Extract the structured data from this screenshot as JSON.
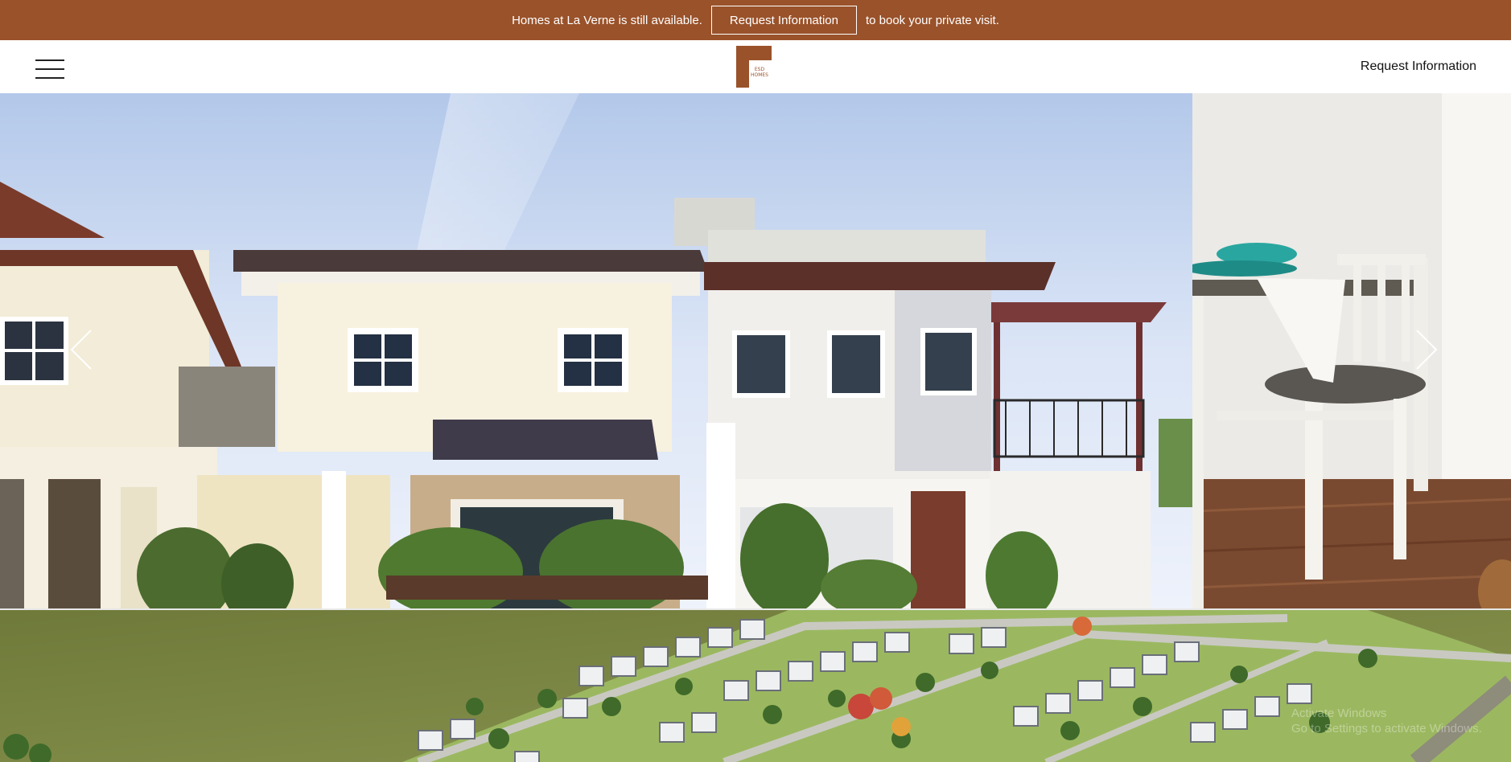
{
  "announcement": {
    "text_before": "Homes at La Verne is still available.",
    "button_label": "Request Information",
    "text_after": "to book your private visit.",
    "background_color": "#9a522a"
  },
  "header": {
    "menu_icon": "hamburger-menu-icon",
    "logo_text_line1": "ESD",
    "logo_text_line2": "HOMES",
    "logo_color": "#9a522a",
    "request_link": "Request Information"
  },
  "slideshow": {
    "prev_icon": "chevron-left-icon",
    "next_icon": "chevron-right-icon",
    "current_slide": "two-storey house exterior",
    "next_slide": "dining chair interior"
  },
  "aerial": {
    "image": "aerial view of subdivision"
  },
  "os_watermark": {
    "line1": "Activate Windows",
    "line2": "Go to Settings to activate Windows."
  }
}
